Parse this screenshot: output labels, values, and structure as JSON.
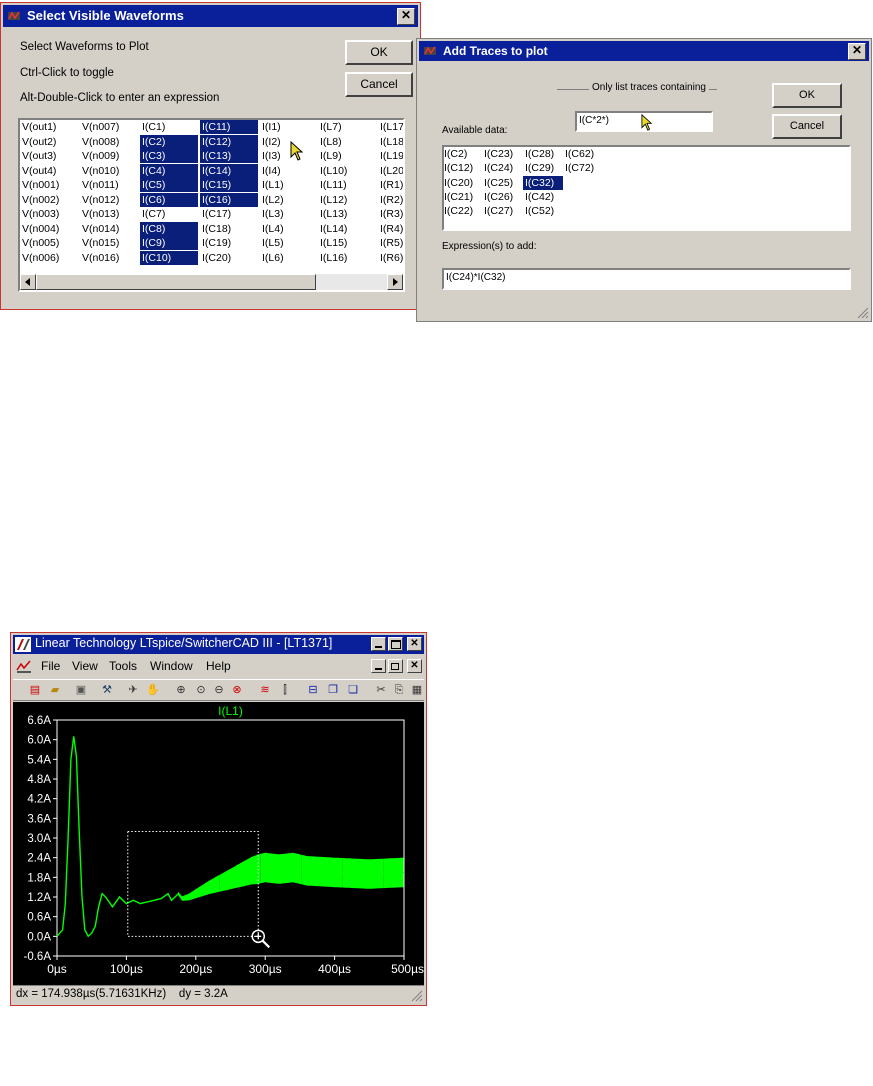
{
  "dialog1": {
    "title": "Select Visible Waveforms",
    "instructions": [
      "Select Waveforms to Plot",
      "Ctrl-Click to toggle",
      "Alt-Double-Click to enter an expression"
    ],
    "ok_label": "OK",
    "cancel_label": "Cancel",
    "columns": [
      [
        "V(out1)",
        "V(out2)",
        "V(out3)",
        "V(out4)",
        "V(n001)",
        "V(n002)",
        "V(n003)",
        "V(n004)",
        "V(n005)",
        "V(n006)"
      ],
      [
        "V(n007)",
        "V(n008)",
        "V(n009)",
        "V(n010)",
        "V(n011)",
        "V(n012)",
        "V(n013)",
        "V(n014)",
        "V(n015)",
        "V(n016)"
      ],
      [
        "I(C1)",
        "I(C2)",
        "I(C3)",
        "I(C4)",
        "I(C5)",
        "I(C6)",
        "I(C7)",
        "I(C8)",
        "I(C9)",
        "I(C10)"
      ],
      [
        "I(C11)",
        "I(C12)",
        "I(C13)",
        "I(C14)",
        "I(C15)",
        "I(C16)",
        "I(C17)",
        "I(C18)",
        "I(C19)",
        "I(C20)"
      ],
      [
        "I(I1)",
        "I(I2)",
        "I(I3)",
        "I(I4)",
        "I(L1)",
        "I(L2)",
        "I(L3)",
        "I(L4)",
        "I(L5)",
        "I(L6)"
      ],
      [
        "I(L7)",
        "I(L8)",
        "I(L9)",
        "I(L10)",
        "I(L11)",
        "I(L12)",
        "I(L13)",
        "I(L14)",
        "I(L15)",
        "I(L16)"
      ],
      [
        "I(L17",
        "I(L18",
        "I(L19",
        "I(L20",
        "I(R1)",
        "I(R2)",
        "I(R3)",
        "I(R4)",
        "I(R5)",
        "I(R6)"
      ]
    ],
    "selected": [
      [
        2,
        1
      ],
      [
        2,
        2
      ],
      [
        2,
        3
      ],
      [
        2,
        4
      ],
      [
        2,
        5
      ],
      [
        2,
        7
      ],
      [
        2,
        8
      ],
      [
        2,
        9
      ],
      [
        3,
        0
      ],
      [
        3,
        1
      ],
      [
        3,
        2
      ],
      [
        3,
        3
      ],
      [
        3,
        4
      ],
      [
        3,
        5
      ]
    ]
  },
  "dialog2": {
    "title": "Add Traces to plot",
    "filter_label": "Only list traces containing",
    "filter_value": "I(C*2*)",
    "available_label": "Available data:",
    "ok_label": "OK",
    "cancel_label": "Cancel",
    "columns": [
      [
        "I(C2)",
        "I(C12)",
        "I(C20)",
        "I(C21)",
        "I(C22)"
      ],
      [
        "I(C23)",
        "I(C24)",
        "I(C25)",
        "I(C26)",
        "I(C27)"
      ],
      [
        "I(C28)",
        "I(C29)",
        "I(C32)",
        "I(C42)",
        "I(C52)"
      ],
      [
        "I(C62)",
        "I(C72)"
      ]
    ],
    "selected": [
      [
        2,
        2
      ]
    ],
    "expression_label": "Expression(s) to add:",
    "expression_value": "I(C24)*I(C32)"
  },
  "ltspice": {
    "title": "Linear Technology LTspice/SwitcherCAD III - [LT1371]",
    "menu": [
      "File",
      "View",
      "Tools",
      "Window",
      "Help"
    ],
    "status_text": "dx = 174.938µs(5.71631KHz)    dy = 3.2A",
    "accent": "#00ff00"
  },
  "chart_data": {
    "type": "line",
    "title": "I(L1)",
    "xlabel": "",
    "ylabel": "",
    "xlim": [
      0,
      500
    ],
    "ylim": [
      -0.6,
      6.6
    ],
    "x_ticks": [
      "0µs",
      "100µs",
      "200µs",
      "300µs",
      "400µs",
      "500µs"
    ],
    "y_ticks": [
      "6.6A",
      "6.0A",
      "5.4A",
      "4.8A",
      "4.2A",
      "3.6A",
      "3.0A",
      "2.4A",
      "1.8A",
      "1.2A",
      "0.6A",
      "0.0A",
      "-0.6A"
    ],
    "grid": false,
    "series": [
      {
        "name": "I(L1)",
        "color": "#00ff00",
        "x": [
          0,
          8,
          12,
          16,
          20,
          24,
          28,
          32,
          36,
          40,
          45,
          50,
          55,
          60,
          65,
          70,
          80,
          90,
          100,
          110,
          120,
          130,
          140,
          150,
          160,
          165,
          170,
          175,
          180,
          190,
          200,
          220,
          250,
          280,
          300,
          320,
          340,
          360,
          400,
          450,
          500
        ],
        "y": [
          0.0,
          0.2,
          1.0,
          3.0,
          5.4,
          6.1,
          5.5,
          3.2,
          1.2,
          0.2,
          0.0,
          0.1,
          0.3,
          0.9,
          1.3,
          1.2,
          0.9,
          1.2,
          1.0,
          1.1,
          1.0,
          1.05,
          1.1,
          1.15,
          1.3,
          1.1,
          1.2,
          1.3,
          1.15,
          1.2,
          1.3,
          1.5,
          1.75,
          2.0,
          2.1,
          2.05,
          2.1,
          2.0,
          1.95,
          1.9,
          1.95
        ]
      }
    ],
    "annotations": {
      "zoom_box": {
        "x": [
          102,
          290
        ],
        "y": [
          0.0,
          3.2
        ]
      }
    }
  }
}
